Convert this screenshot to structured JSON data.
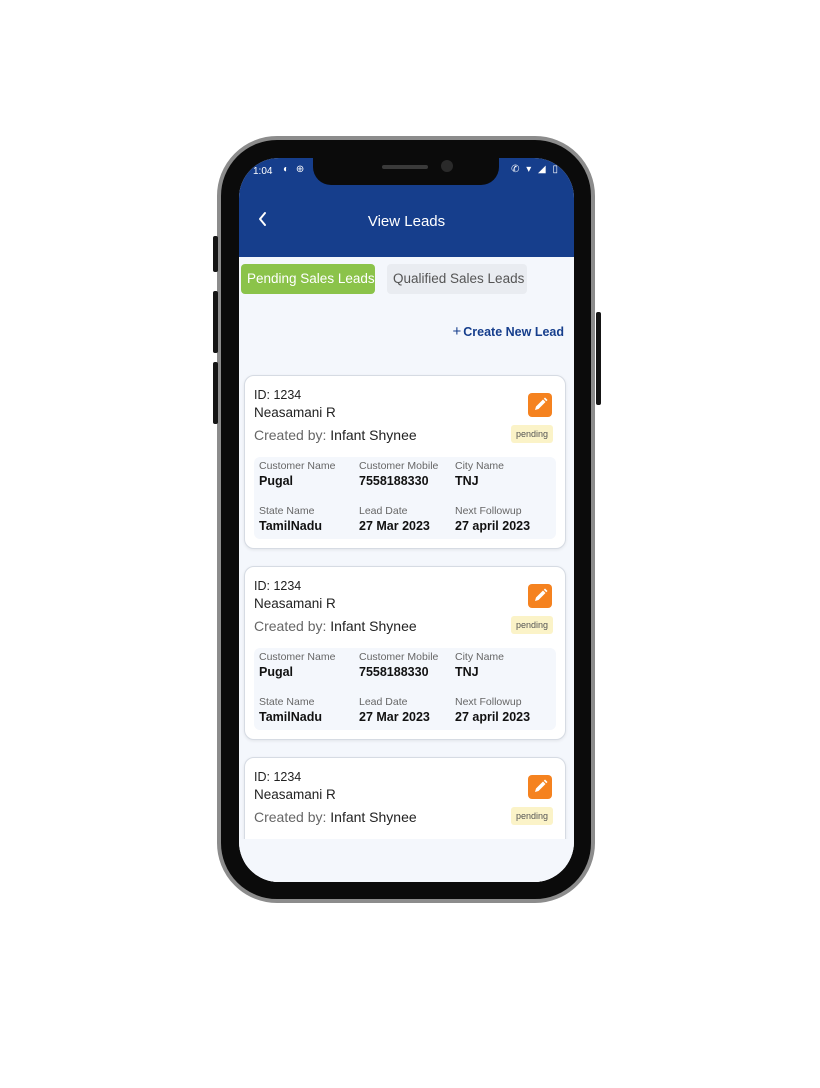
{
  "status_bar": {
    "time": "1:04",
    "left_icons": "◐ ⊕",
    "right_icons": "✆ ▾ ◢ ▯"
  },
  "header": {
    "title": "View Leads"
  },
  "tabs": [
    {
      "label": "Pending Sales Leads",
      "active": true
    },
    {
      "label": "Qualified Sales Leads",
      "active": false
    }
  ],
  "create_lead": {
    "label": "Create New Lead"
  },
  "labels": {
    "created_by": "Created by:",
    "customer_name": "Customer Name",
    "customer_mobile": "Customer Mobile",
    "city_name": "City Name",
    "state_name": "State Name",
    "lead_date": "Lead Date",
    "next_followup": "Next Followup"
  },
  "leads": [
    {
      "id": "ID: 1234",
      "name": "Neasamani R",
      "created_by": "Infant Shynee",
      "status": "pending",
      "customer_name": "Pugal",
      "customer_mobile": "7558188330",
      "city_name": "TNJ",
      "state_name": "TamilNadu",
      "lead_date": "27 Mar 2023",
      "next_followup": "27 april 2023"
    },
    {
      "id": "ID: 1234",
      "name": "Neasamani R",
      "created_by": "Infant Shynee",
      "status": "pending",
      "customer_name": "Pugal",
      "customer_mobile": "7558188330",
      "city_name": "TNJ",
      "state_name": "TamilNadu",
      "lead_date": "27 Mar 2023",
      "next_followup": "27 april 2023"
    },
    {
      "id": "ID: 1234",
      "name": "Neasamani R",
      "created_by": "Infant Shynee",
      "status": "pending"
    }
  ],
  "colors": {
    "primary": "#163e8c",
    "active_tab": "#8bc34a",
    "edit_button": "#f5821f",
    "badge": "#fbf3c8"
  }
}
